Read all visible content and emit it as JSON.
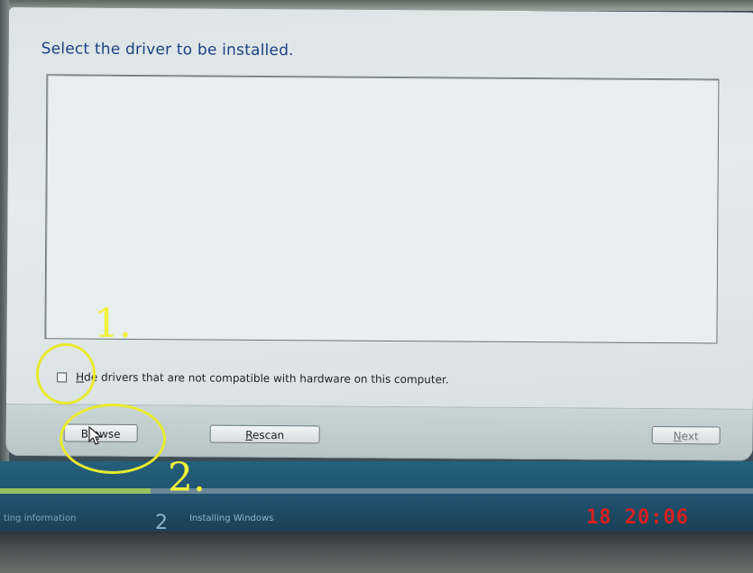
{
  "dialog": {
    "title": "Select the driver to be installed.",
    "hide_label_prefix": "H",
    "hide_label_rest": "de drivers that are not compatible with hardware on this computer.",
    "hide_checked": false
  },
  "buttons": {
    "browse_a": "Br",
    "browse_u": "o",
    "browse_b": "wse",
    "rescan_u": "R",
    "rescan_b": "escan",
    "next_u": "N",
    "next_b": "ext"
  },
  "setup": {
    "step1_label": "ting information",
    "step2_number": "2",
    "step2_label": "Installing Windows",
    "progress_fraction": 0.2
  },
  "overlay": {
    "clock": "18  20:06",
    "annotation1": "1.",
    "annotation2": "2."
  },
  "colors": {
    "title": "#1d3f83",
    "annotation": "#e8ea2f",
    "clock": "#d62020",
    "progress": "#9bbf60"
  }
}
